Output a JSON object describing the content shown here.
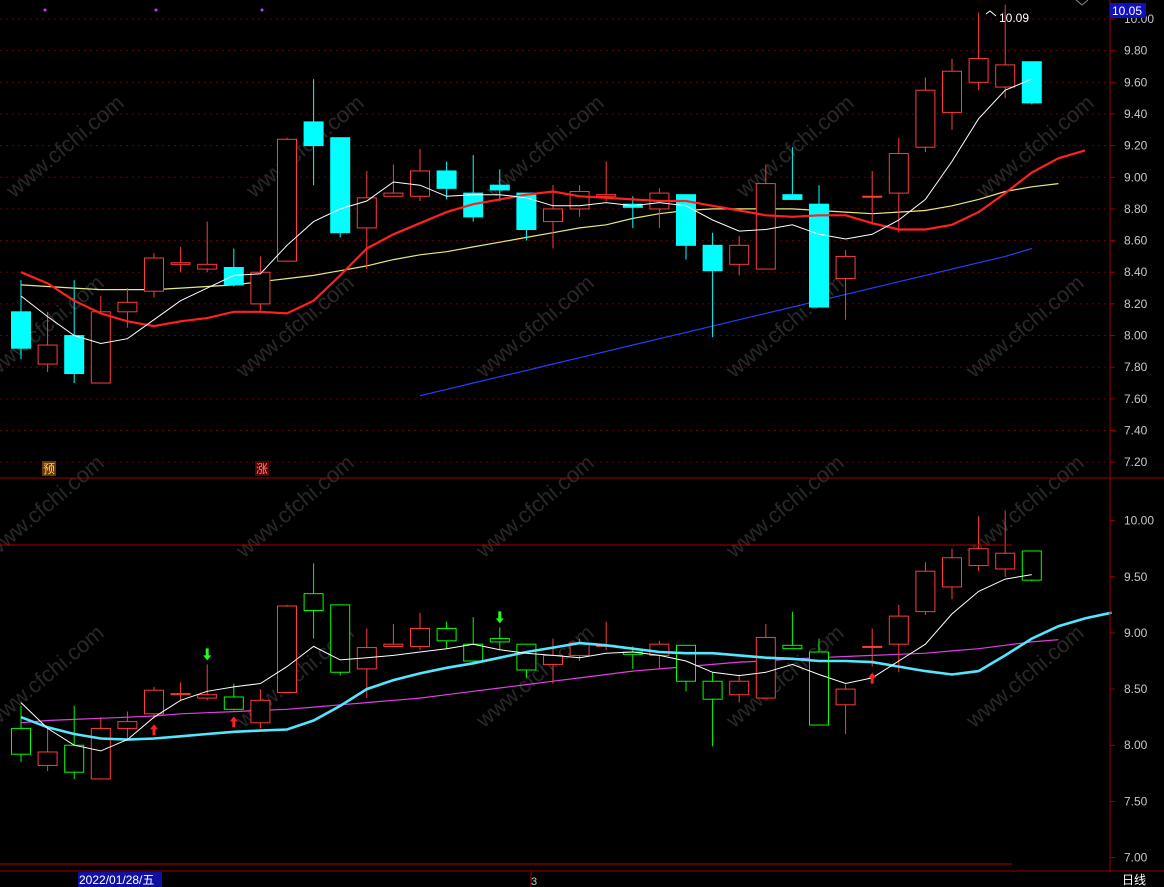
{
  "current_price_label": "10.05",
  "high_marker_label": "10.09",
  "date_label": "2022/01/28/五",
  "page_marker": "3",
  "period_button": "日线",
  "signals": {
    "pre": "预",
    "rise": "涨"
  },
  "watermark": "www.cfchi.com",
  "colors": {
    "up": "#ff3b3b",
    "down": "#00ffff",
    "ma5": "#ffffff",
    "ma10": "#ff2020",
    "ma20": "#e8e880",
    "ma60": "#2a3cff",
    "low_up": "#ff3b3b",
    "low_down": "#00ff00",
    "low_ma1": "#ffffff",
    "low_ma2": "#55e6ff",
    "low_ma3": "#e040e0"
  },
  "chart_data": [
    {
      "type": "candlestick",
      "panel": "upper",
      "ylim": [
        7.1,
        10.12
      ],
      "ticks": [
        "10.00",
        "9.80",
        "9.60",
        "9.40",
        "9.20",
        "9.00",
        "8.80",
        "8.60",
        "8.40",
        "8.20",
        "8.00",
        "7.80",
        "7.60",
        "7.40",
        "7.20"
      ],
      "candles": [
        {
          "o": 8.15,
          "h": 8.35,
          "l": 7.85,
          "c": 7.92
        },
        {
          "o": 7.82,
          "h": 8.15,
          "l": 7.77,
          "c": 7.94
        },
        {
          "o": 8.0,
          "h": 8.35,
          "l": 7.7,
          "c": 7.76
        },
        {
          "o": 7.7,
          "h": 8.25,
          "l": 7.7,
          "c": 8.15
        },
        {
          "o": 8.15,
          "h": 8.3,
          "l": 8.05,
          "c": 8.21
        },
        {
          "o": 8.28,
          "h": 8.52,
          "l": 8.24,
          "c": 8.49
        },
        {
          "o": 8.45,
          "h": 8.56,
          "l": 8.4,
          "c": 8.46
        },
        {
          "o": 8.42,
          "h": 8.72,
          "l": 8.4,
          "c": 8.45
        },
        {
          "o": 8.43,
          "h": 8.55,
          "l": 8.31,
          "c": 8.32
        },
        {
          "o": 8.2,
          "h": 8.5,
          "l": 8.15,
          "c": 8.4
        },
        {
          "o": 8.47,
          "h": 9.25,
          "l": 8.47,
          "c": 9.24
        },
        {
          "o": 9.35,
          "h": 9.62,
          "l": 8.95,
          "c": 9.2
        },
        {
          "o": 9.25,
          "h": 9.25,
          "l": 8.62,
          "c": 8.65
        },
        {
          "o": 8.68,
          "h": 9.04,
          "l": 8.42,
          "c": 8.87
        },
        {
          "o": 8.88,
          "h": 9.08,
          "l": 8.88,
          "c": 8.9
        },
        {
          "o": 8.88,
          "h": 9.18,
          "l": 8.85,
          "c": 9.04
        },
        {
          "o": 9.04,
          "h": 9.1,
          "l": 8.86,
          "c": 8.93
        },
        {
          "o": 8.9,
          "h": 9.14,
          "l": 8.72,
          "c": 8.75
        },
        {
          "o": 8.95,
          "h": 9.05,
          "l": 8.85,
          "c": 8.92
        },
        {
          "o": 8.9,
          "h": 8.9,
          "l": 8.6,
          "c": 8.67
        },
        {
          "o": 8.72,
          "h": 8.95,
          "l": 8.55,
          "c": 8.8
        },
        {
          "o": 8.8,
          "h": 8.95,
          "l": 8.75,
          "c": 8.91
        },
        {
          "o": 8.88,
          "h": 9.1,
          "l": 8.85,
          "c": 8.89
        },
        {
          "o": 8.83,
          "h": 8.88,
          "l": 8.68,
          "c": 8.81
        },
        {
          "o": 8.8,
          "h": 8.93,
          "l": 8.68,
          "c": 8.9
        },
        {
          "o": 8.89,
          "h": 8.89,
          "l": 8.48,
          "c": 8.57
        },
        {
          "o": 8.57,
          "h": 8.65,
          "l": 7.99,
          "c": 8.41
        },
        {
          "o": 8.45,
          "h": 8.63,
          "l": 8.38,
          "c": 8.57
        },
        {
          "o": 8.42,
          "h": 9.08,
          "l": 8.42,
          "c": 8.96
        },
        {
          "o": 8.89,
          "h": 9.19,
          "l": 8.86,
          "c": 8.86
        },
        {
          "o": 8.83,
          "h": 8.95,
          "l": 8.2,
          "c": 8.18
        },
        {
          "o": 8.36,
          "h": 8.54,
          "l": 8.1,
          "c": 8.5
        },
        {
          "o": 8.88,
          "h": 9.04,
          "l": 8.7,
          "c": 8.88
        },
        {
          "o": 8.9,
          "h": 9.25,
          "l": 8.65,
          "c": 9.15
        },
        {
          "o": 9.19,
          "h": 9.63,
          "l": 9.16,
          "c": 9.55
        },
        {
          "o": 9.41,
          "h": 9.75,
          "l": 9.3,
          "c": 9.67
        },
        {
          "o": 9.6,
          "h": 10.04,
          "l": 9.55,
          "c": 9.75
        },
        {
          "o": 9.57,
          "h": 10.09,
          "l": 9.5,
          "c": 9.71
        },
        {
          "o": 9.73,
          "h": 9.73,
          "l": 9.46,
          "c": 9.47
        }
      ],
      "ma5": [
        8.25,
        8.12,
        8.0,
        7.95,
        7.98,
        8.1,
        8.22,
        8.3,
        8.38,
        8.39,
        8.57,
        8.72,
        8.8,
        8.85,
        8.97,
        8.95,
        8.88,
        8.89,
        8.89,
        8.87,
        8.82,
        8.82,
        8.84,
        8.82,
        8.84,
        8.82,
        8.73,
        8.66,
        8.67,
        8.7,
        8.64,
        8.61,
        8.64,
        8.73,
        8.86,
        9.1,
        9.37,
        9.55,
        9.62
      ],
      "ma10": [
        8.4,
        8.33,
        8.22,
        8.14,
        8.09,
        8.06,
        8.09,
        8.11,
        8.15,
        8.15,
        8.14,
        8.22,
        8.38,
        8.55,
        8.64,
        8.71,
        8.78,
        8.83,
        8.86,
        8.89,
        8.91,
        8.88,
        8.87,
        8.86,
        8.85,
        8.85,
        8.82,
        8.79,
        8.76,
        8.75,
        8.76,
        8.76,
        8.71,
        8.67,
        8.67,
        8.7,
        8.78,
        8.9,
        9.03,
        9.12,
        9.17
      ],
      "ma20": [
        8.32,
        8.31,
        8.3,
        8.29,
        8.29,
        8.29,
        8.3,
        8.31,
        8.32,
        8.34,
        8.36,
        8.38,
        8.41,
        8.44,
        8.48,
        8.51,
        8.53,
        8.56,
        8.59,
        8.62,
        8.65,
        8.68,
        8.7,
        8.74,
        8.77,
        8.79,
        8.8,
        8.8,
        8.8,
        8.8,
        8.79,
        8.78,
        8.77,
        8.78,
        8.79,
        8.82,
        8.86,
        8.91,
        8.94,
        8.96
      ],
      "ma60": [
        7.62,
        7.66,
        7.7,
        7.74,
        7.78,
        7.82,
        7.86,
        7.9,
        7.94,
        7.98,
        8.02,
        8.06,
        8.1,
        8.14,
        8.18,
        8.22,
        8.26,
        8.3,
        8.34,
        8.38,
        8.42,
        8.46,
        8.5,
        8.55
      ]
    },
    {
      "type": "candlestick",
      "panel": "lower",
      "ylim": [
        6.88,
        10.38
      ],
      "ticks": [
        "10.00",
        "9.50",
        "9.00",
        "8.50",
        "8.00",
        "7.50",
        "7.00"
      ],
      "ma1": [
        8.38,
        8.15,
        8.0,
        7.95,
        8.05,
        8.25,
        8.4,
        8.48,
        8.52,
        8.55,
        8.7,
        8.88,
        8.76,
        8.78,
        8.8,
        8.83,
        8.86,
        8.9,
        8.85,
        8.82,
        8.8,
        8.78,
        8.82,
        8.83,
        8.8,
        8.75,
        8.65,
        8.62,
        8.65,
        8.72,
        8.63,
        8.55,
        8.6,
        8.75,
        8.9,
        9.17,
        9.37,
        9.48,
        9.52
      ],
      "ma2": [
        8.25,
        8.16,
        8.1,
        8.06,
        8.05,
        8.06,
        8.08,
        8.1,
        8.12,
        8.13,
        8.14,
        8.22,
        8.35,
        8.5,
        8.58,
        8.64,
        8.69,
        8.73,
        8.78,
        8.83,
        8.87,
        8.91,
        8.89,
        8.86,
        8.83,
        8.82,
        8.82,
        8.8,
        8.78,
        8.77,
        8.75,
        8.75,
        8.74,
        8.7,
        8.66,
        8.63,
        8.66,
        8.8,
        8.95,
        9.06,
        9.13,
        9.18
      ],
      "ma3": [
        8.2,
        8.22,
        8.23,
        8.24,
        8.25,
        8.26,
        8.28,
        8.29,
        8.3,
        8.31,
        8.32,
        8.34,
        8.36,
        8.38,
        8.4,
        8.42,
        8.45,
        8.48,
        8.51,
        8.54,
        8.57,
        8.6,
        8.63,
        8.66,
        8.68,
        8.7,
        8.72,
        8.74,
        8.75,
        8.77,
        8.78,
        8.79,
        8.8,
        8.81,
        8.82,
        8.84,
        8.86,
        8.89,
        8.92,
        8.94
      ]
    }
  ]
}
